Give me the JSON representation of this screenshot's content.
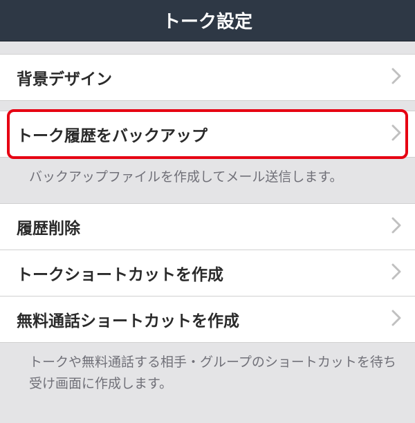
{
  "header": {
    "title": "トーク設定"
  },
  "items": {
    "background_design": {
      "label": "背景デザイン"
    },
    "backup_history": {
      "label": "トーク履歴をバックアップ"
    },
    "backup_helper": "バックアップファイルを作成してメール送信します。",
    "delete_history": {
      "label": "履歴削除"
    },
    "talk_shortcut": {
      "label": "トークショートカットを作成"
    },
    "call_shortcut": {
      "label": "無料通話ショートカットを作成"
    },
    "shortcut_helper": "トークや無料通話する相手・グループのショートカットを待ち受け画面に作成します。"
  }
}
